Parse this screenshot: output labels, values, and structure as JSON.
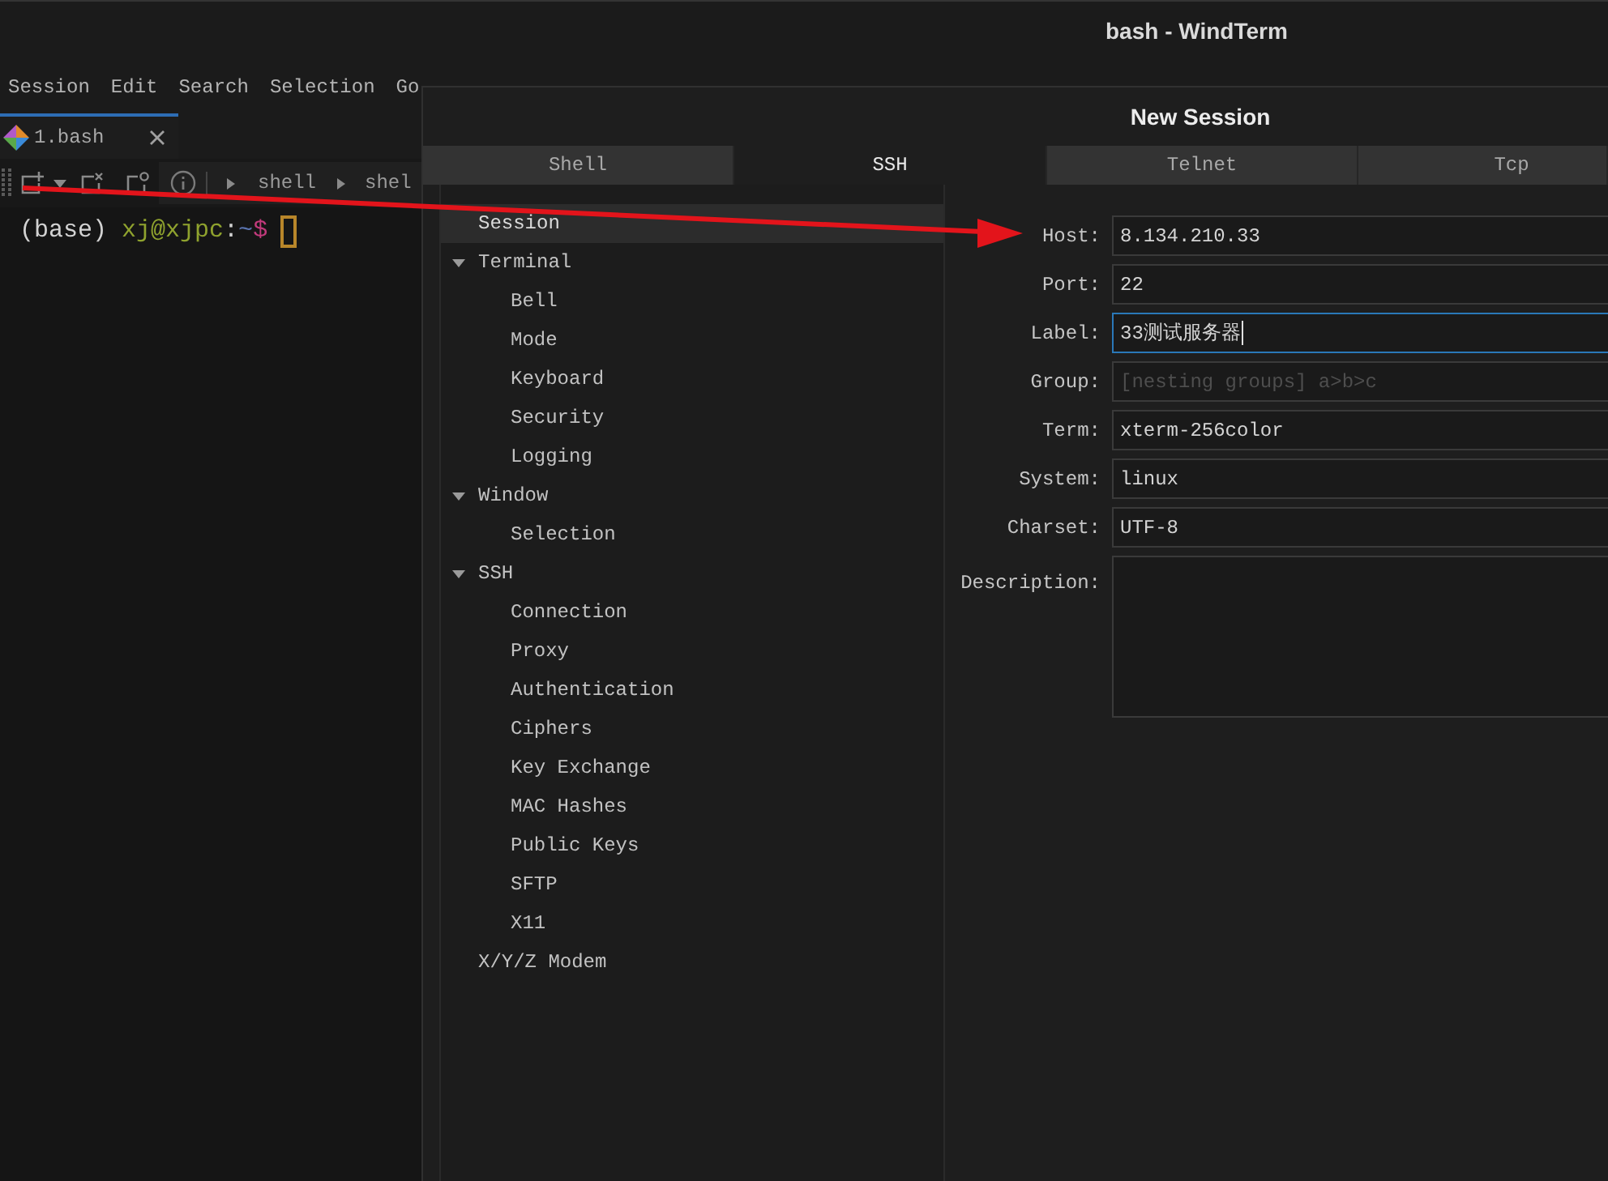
{
  "window": {
    "title": "bash - WindTerm"
  },
  "menu_bar": [
    "Session",
    "Edit",
    "Search",
    "Selection",
    "Go"
  ],
  "tabs": [
    {
      "label": "1.bash",
      "selected": true
    }
  ],
  "toolbar": {
    "breadcrumb": [
      "shell",
      "shel"
    ]
  },
  "terminal": {
    "prompt": [
      {
        "text": "(base)",
        "kind": "env"
      },
      {
        "text": "xj@xjpc",
        "kind": "user"
      },
      {
        "text": ":",
        "kind": "plain"
      },
      {
        "text": "~",
        "kind": "path"
      },
      {
        "text": "$",
        "kind": "symbol"
      }
    ],
    "cursor": true
  },
  "dialog": {
    "title": "New Session",
    "tabs": [
      {
        "label": "Shell",
        "selected": false
      },
      {
        "label": "SSH",
        "selected": true
      },
      {
        "label": "Telnet",
        "selected": false
      },
      {
        "label": "Tcp",
        "selected": false
      }
    ],
    "tree": [
      {
        "label": "Session",
        "selected": true
      },
      {
        "label": "Terminal",
        "selected": false,
        "expanded": true,
        "children": [
          {
            "label": "Bell",
            "selected": false
          },
          {
            "label": "Mode",
            "selected": false
          },
          {
            "label": "Keyboard",
            "selected": false
          },
          {
            "label": "Security",
            "selected": false
          },
          {
            "label": "Logging",
            "selected": false
          }
        ]
      },
      {
        "label": "Window",
        "selected": false,
        "expanded": true,
        "children": [
          {
            "label": "Selection",
            "selected": false
          }
        ]
      },
      {
        "label": "SSH",
        "selected": false,
        "expanded": true,
        "children": [
          {
            "label": "Connection",
            "selected": false
          },
          {
            "label": "Proxy",
            "selected": false
          },
          {
            "label": "Authentication",
            "selected": false
          },
          {
            "label": "Ciphers",
            "selected": false
          },
          {
            "label": "Key Exchange",
            "selected": false
          },
          {
            "label": "MAC Hashes",
            "selected": false
          },
          {
            "label": "Public Keys",
            "selected": false
          },
          {
            "label": "SFTP",
            "selected": false
          },
          {
            "label": "X11",
            "selected": false
          }
        ]
      },
      {
        "label": "X/Y/Z Modem",
        "selected": false
      }
    ],
    "form": [
      {
        "label": "Host:",
        "kind": "text",
        "value": "8.134.210.33",
        "focused": false
      },
      {
        "label": "Port:",
        "kind": "text",
        "value": "22",
        "focused": false
      },
      {
        "label": "Label:",
        "kind": "text",
        "value": "33测试服务器",
        "focused": true
      },
      {
        "label": "Group:",
        "kind": "text",
        "placeholder": "[nesting groups] a>b>c",
        "focused": false
      },
      {
        "label": "Term:",
        "kind": "text",
        "value": "xterm-256color",
        "focused": false
      },
      {
        "label": "System:",
        "kind": "text",
        "value": "linux",
        "focused": false
      },
      {
        "label": "Charset:",
        "kind": "text",
        "value": "UTF-8",
        "focused": false
      },
      {
        "label": "Description:",
        "kind": "textarea",
        "focused": false
      }
    ]
  }
}
